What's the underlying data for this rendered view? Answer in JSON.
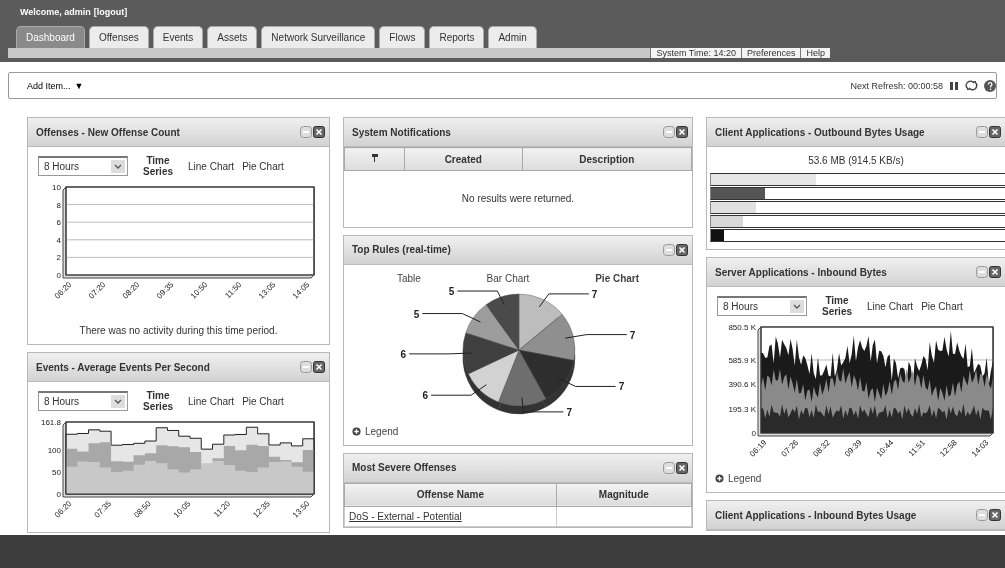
{
  "header": {
    "welcome": "Welcome, admin",
    "logout": "[logout]"
  },
  "tabs": [
    {
      "label": "Dashboard",
      "selected": true
    },
    {
      "label": "Offenses",
      "selected": false
    },
    {
      "label": "Events",
      "selected": false
    },
    {
      "label": "Assets",
      "selected": false
    },
    {
      "label": "Network Surveillance",
      "selected": false
    },
    {
      "label": "Flows",
      "selected": false
    },
    {
      "label": "Reports",
      "selected": false
    },
    {
      "label": "Admin",
      "selected": false
    }
  ],
  "system_time": "System Time: 14:20",
  "links": [
    "Preferences",
    "Help"
  ],
  "toolbar": {
    "add_item": "Add Item...",
    "add_item_caret": "▼",
    "next_refresh": "Next Refresh: 00:00:58"
  },
  "columns": [
    [
      {
        "kind": "timeseries",
        "title": "Offenses - New Offense Count",
        "range": "8 Hours",
        "views": [
          {
            "label": "Time Series",
            "selected": true
          },
          {
            "label": "Line Chart",
            "selected": false
          },
          {
            "label": "Pie Chart",
            "selected": false
          }
        ],
        "chart": {
          "kind": "empty",
          "y_ticks": [
            "10",
            "8",
            "6",
            "4",
            "2",
            "0"
          ],
          "x_ticks": [
            "06:20",
            "07:20",
            "08:20",
            "09:35",
            "10:50",
            "11:50",
            "13:05",
            "14:05"
          ]
        },
        "message": "There was no activity during this time period."
      },
      {
        "kind": "timeseries",
        "title": "Events - Average Events Per Second",
        "range": "8 Hours",
        "views": [
          {
            "label": "Time Series",
            "selected": true
          },
          {
            "label": "Line Chart",
            "selected": false
          },
          {
            "label": "Pie Chart",
            "selected": false
          }
        ],
        "chart": {
          "kind": "steps",
          "y_ticks": [
            "161.8",
            "100",
            "50",
            "0"
          ],
          "x_ticks": [
            "06:20",
            "07:35",
            "08:50",
            "10:05",
            "11:20",
            "12:35",
            "13:50"
          ]
        }
      }
    ],
    [
      {
        "kind": "notifications",
        "title": "System Notifications",
        "columns": [
          "Created",
          "Description"
        ],
        "empty": "No results were returned."
      },
      {
        "kind": "pie",
        "title": "Top Rules (real-time)",
        "views": [
          {
            "label": "Table",
            "selected": false
          },
          {
            "label": "Bar Chart",
            "selected": false
          },
          {
            "label": "Pie Chart",
            "selected": true
          }
        ],
        "chart_data": {
          "type": "pie",
          "values": [
            7,
            7,
            7,
            7,
            6,
            6,
            5,
            5
          ],
          "data_labels": true
        },
        "legend": "Legend"
      },
      {
        "kind": "table",
        "title": "Most Severe Offenses",
        "columns": [
          "Offense Name",
          "Magnitude"
        ],
        "rows": [
          [
            "DoS - External - Potential",
            ""
          ]
        ]
      }
    ],
    [
      {
        "kind": "bars",
        "title": "Client Applications - Outbound Bytes Usage",
        "summary": "53.6 MB (914.5 KB/s)",
        "bars": [
          {
            "level": 0.33,
            "color": "#e6e6e6"
          },
          {
            "level": 0.17,
            "color": "#555555"
          },
          {
            "level": 0.14,
            "color": "#e0e0e0"
          },
          {
            "level": 0.1,
            "color": "#d8d8d8"
          },
          {
            "level": 0.04,
            "color": "#111111"
          }
        ]
      },
      {
        "kind": "timeseries",
        "title": "Server Applications - Inbound Bytes",
        "range": "8 Hours",
        "views": [
          {
            "label": "Time Series",
            "selected": true
          },
          {
            "label": "Line Chart",
            "selected": false
          },
          {
            "label": "Pie Chart",
            "selected": false
          }
        ],
        "chart": {
          "kind": "dense",
          "y_ticks": [
            "850.5 K",
            "585.9 K",
            "390.6 K",
            "195.3 K",
            "0"
          ],
          "x_ticks": [
            "06:19",
            "07:26",
            "08:32",
            "09:39",
            "10:44",
            "11:51",
            "12:58",
            "14:03"
          ]
        },
        "legend": "Legend"
      },
      {
        "kind": "collapsed",
        "title": "Client Applications - Inbound Bytes Usage"
      }
    ]
  ]
}
